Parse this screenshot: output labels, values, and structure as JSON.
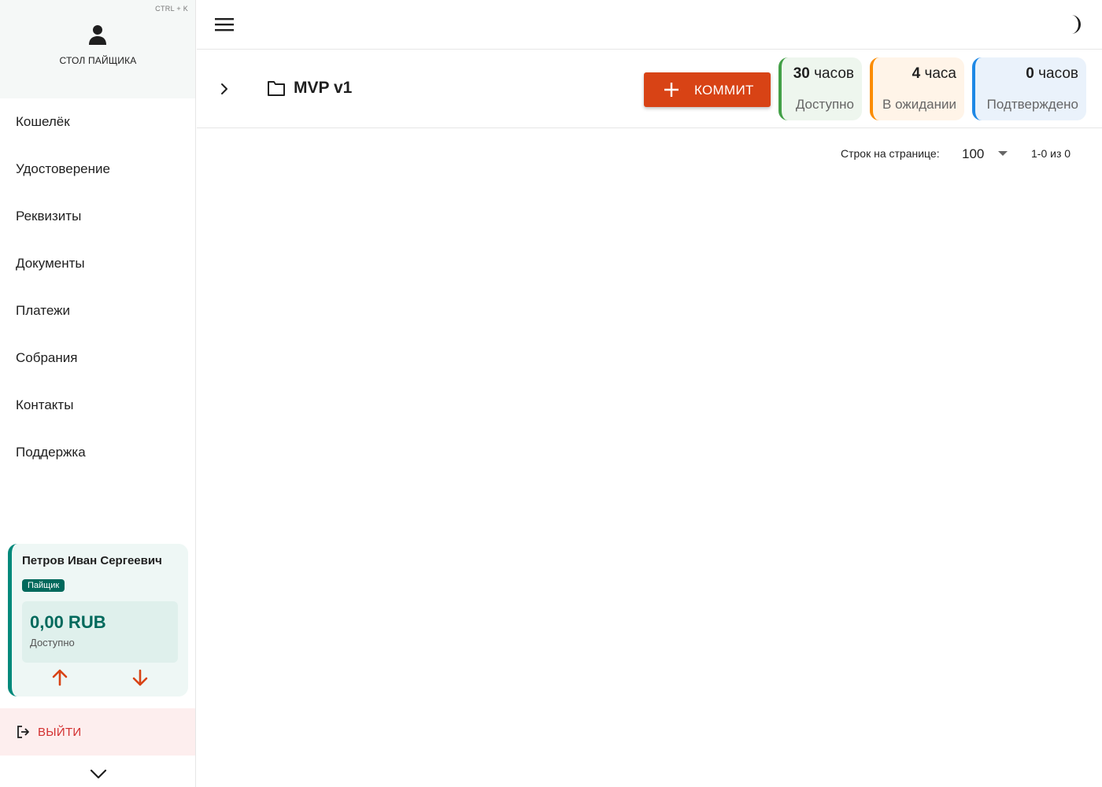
{
  "sidebar": {
    "shortcut": "CTRL + K",
    "title": "СТОЛ ПАЙЩИКА",
    "items": [
      {
        "label": "Кошелёк"
      },
      {
        "label": "Удостоверение"
      },
      {
        "label": "Реквизиты"
      },
      {
        "label": "Документы"
      },
      {
        "label": "Платежи"
      },
      {
        "label": "Собрания"
      },
      {
        "label": "Контакты"
      },
      {
        "label": "Поддержка"
      }
    ],
    "user": {
      "name": "Петров Иван Сергеевич",
      "role": "Пайщик",
      "balance": "0,00 RUB",
      "balance_label": "Доступно"
    },
    "logout_label": "ВЫЙТИ"
  },
  "toolbar": {
    "project_title": "MVP v1",
    "commit_label": "КОММИТ",
    "stats": {
      "available": {
        "number": "30",
        "unit": "часов",
        "label": "Доступно"
      },
      "pending": {
        "number": "4",
        "unit": "часа",
        "label": "В ожидании"
      },
      "confirmed": {
        "number": "0",
        "unit": "часов",
        "label": "Подтверждено"
      }
    }
  },
  "pagination": {
    "rows_label": "Строк на странице:",
    "rows_value": "100",
    "range": "1-0 из 0"
  },
  "colors": {
    "accent": "#d84315",
    "brand": "#00695c",
    "available": "#43a047",
    "pending": "#fb8c00",
    "confirmed": "#1e88e5",
    "logout": "#d32f2f"
  },
  "icons": [
    "user-icon",
    "menu-icon",
    "dark-mode-icon",
    "chevron-right-icon",
    "folder-icon",
    "plus-icon",
    "arrow-up-icon",
    "arrow-down-icon",
    "logout-icon",
    "chevron-down-icon"
  ]
}
